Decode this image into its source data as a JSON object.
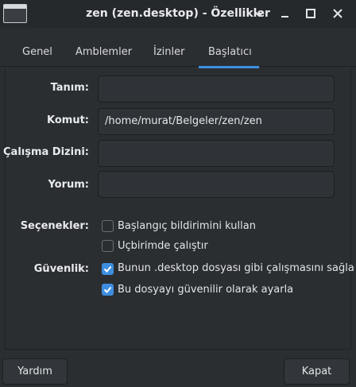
{
  "window": {
    "title": "zen (zen.desktop) - Özellikler",
    "icon": "app-window-icon"
  },
  "titlebar_controls": [
    "chevron-down-icon",
    "minimize-icon",
    "maximize-icon",
    "close-icon"
  ],
  "tabs": [
    {
      "label": "Genel",
      "active": false
    },
    {
      "label": "Amblemler",
      "active": false
    },
    {
      "label": "İzinler",
      "active": false
    },
    {
      "label": "Başlatıcı",
      "active": true
    }
  ],
  "form": {
    "tanim": {
      "label": "Tanım:",
      "value": ""
    },
    "komut": {
      "label": "Komut:",
      "value": "/home/murat/Belgeler/zen/zen"
    },
    "calisma_dizini": {
      "label": "Çalışma Dizini:",
      "value": ""
    },
    "yorum": {
      "label": "Yorum:",
      "value": ""
    }
  },
  "secenekler": {
    "label": "Seçenekler:",
    "options": [
      {
        "label": "Başlangıç bildirimini kullan",
        "checked": false
      },
      {
        "label": "Uçbirimde çalıştır",
        "checked": false
      }
    ]
  },
  "guvenlik": {
    "label": "Güvenlik:",
    "options": [
      {
        "label": "Bunun .desktop dosyası gibi çalışmasını sağla",
        "checked": true
      },
      {
        "label": "Bu dosyayı güvenilir olarak ayarla",
        "checked": true
      }
    ]
  },
  "buttons": {
    "help": "Yardım",
    "close": "Kapat"
  },
  "colors": {
    "accent": "#3d8ee0",
    "background": "#2b2e31",
    "titlebar": "#26292c"
  }
}
